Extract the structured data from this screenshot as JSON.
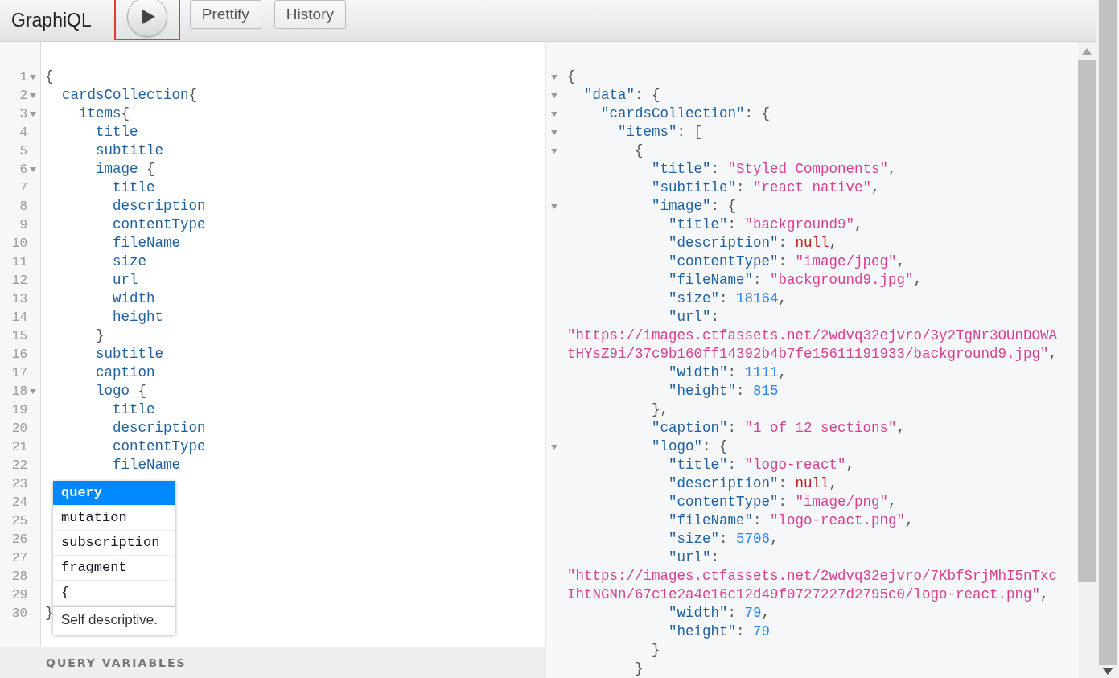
{
  "toolbar": {
    "title": "GraphiQL",
    "run_button": {
      "highlighted": true
    },
    "buttons": [
      "Prettify",
      "History"
    ]
  },
  "query_editor": {
    "lines": [
      {
        "n": "1",
        "fold": true,
        "code": [
          {
            "kind": "punct",
            "text": "{"
          }
        ]
      },
      {
        "n": "2",
        "fold": true,
        "code": [
          {
            "kind": "field",
            "text": "  cardsCollection"
          },
          {
            "kind": "punct",
            "text": "{"
          }
        ]
      },
      {
        "n": "3",
        "fold": true,
        "code": [
          {
            "kind": "field",
            "text": "    items"
          },
          {
            "kind": "punct",
            "text": "{"
          }
        ]
      },
      {
        "n": "4",
        "fold": false,
        "code": [
          {
            "kind": "field",
            "text": "      title"
          }
        ]
      },
      {
        "n": "5",
        "fold": false,
        "code": [
          {
            "kind": "field",
            "text": "      subtitle"
          }
        ]
      },
      {
        "n": "6",
        "fold": true,
        "code": [
          {
            "kind": "field",
            "text": "      image "
          },
          {
            "kind": "punct",
            "text": "{"
          }
        ]
      },
      {
        "n": "7",
        "fold": false,
        "code": [
          {
            "kind": "field",
            "text": "        title"
          }
        ]
      },
      {
        "n": "8",
        "fold": false,
        "code": [
          {
            "kind": "field",
            "text": "        description"
          }
        ]
      },
      {
        "n": "9",
        "fold": false,
        "code": [
          {
            "kind": "field",
            "text": "        contentType"
          }
        ]
      },
      {
        "n": "10",
        "fold": false,
        "code": [
          {
            "kind": "field",
            "text": "        fileName"
          }
        ]
      },
      {
        "n": "11",
        "fold": false,
        "code": [
          {
            "kind": "field",
            "text": "        size"
          }
        ]
      },
      {
        "n": "12",
        "fold": false,
        "code": [
          {
            "kind": "field",
            "text": "        url"
          }
        ]
      },
      {
        "n": "13",
        "fold": false,
        "code": [
          {
            "kind": "field",
            "text": "        width"
          }
        ]
      },
      {
        "n": "14",
        "fold": false,
        "code": [
          {
            "kind": "field",
            "text": "        height"
          }
        ]
      },
      {
        "n": "15",
        "fold": false,
        "code": [
          {
            "kind": "punct",
            "text": "      }"
          }
        ]
      },
      {
        "n": "16",
        "fold": false,
        "code": [
          {
            "kind": "field",
            "text": "      subtitle"
          }
        ]
      },
      {
        "n": "17",
        "fold": false,
        "code": [
          {
            "kind": "field",
            "text": "      caption"
          }
        ]
      },
      {
        "n": "18",
        "fold": true,
        "code": [
          {
            "kind": "field",
            "text": "      logo "
          },
          {
            "kind": "punct",
            "text": "{"
          }
        ]
      },
      {
        "n": "19",
        "fold": false,
        "code": [
          {
            "kind": "field",
            "text": "        title"
          }
        ]
      },
      {
        "n": "20",
        "fold": false,
        "code": [
          {
            "kind": "field",
            "text": "        description"
          }
        ]
      },
      {
        "n": "21",
        "fold": false,
        "code": [
          {
            "kind": "field",
            "text": "        contentType"
          }
        ]
      },
      {
        "n": "22",
        "fold": false,
        "code": [
          {
            "kind": "field",
            "text": "        fileName"
          }
        ]
      },
      {
        "n": "23",
        "fold": false
      },
      {
        "n": "24",
        "fold": false
      },
      {
        "n": "25",
        "fold": false
      },
      {
        "n": "26",
        "fold": false
      },
      {
        "n": "27",
        "fold": false
      },
      {
        "n": "28",
        "fold": false
      },
      {
        "n": "29",
        "fold": false
      },
      {
        "n": "30",
        "fold": false,
        "code": [
          {
            "kind": "punct",
            "text": "}"
          }
        ]
      }
    ],
    "autocomplete": {
      "items": [
        {
          "label": "query",
          "selected": true
        },
        {
          "label": "mutation",
          "selected": false
        },
        {
          "label": "subscription",
          "selected": false
        },
        {
          "label": "fragment",
          "selected": false
        },
        {
          "label": "{",
          "selected": false
        }
      ],
      "description": "Self descriptive."
    },
    "variables_label": "QUERY VARIABLES"
  },
  "result": {
    "lines": [
      {
        "fold": true,
        "code": [
          {
            "kind": "punct",
            "text": "{"
          }
        ]
      },
      {
        "fold": true,
        "code": [
          {
            "kind": "key",
            "text": "  \"data\""
          },
          {
            "kind": "punct",
            "text": ": {"
          }
        ]
      },
      {
        "fold": true,
        "code": [
          {
            "kind": "key",
            "text": "    \"cardsCollection\""
          },
          {
            "kind": "punct",
            "text": ": {"
          }
        ]
      },
      {
        "fold": true,
        "code": [
          {
            "kind": "key",
            "text": "      \"items\""
          },
          {
            "kind": "punct",
            "text": ": ["
          }
        ]
      },
      {
        "fold": true,
        "code": [
          {
            "kind": "punct",
            "text": "        {"
          }
        ]
      },
      {
        "fold": false,
        "code": [
          {
            "kind": "key",
            "text": "          \"title\""
          },
          {
            "kind": "punct",
            "text": ": "
          },
          {
            "kind": "string",
            "text": "\"Styled Components\""
          },
          {
            "kind": "punct",
            "text": ","
          }
        ]
      },
      {
        "fold": false,
        "code": [
          {
            "kind": "key",
            "text": "          \"subtitle\""
          },
          {
            "kind": "punct",
            "text": ": "
          },
          {
            "kind": "string",
            "text": "\"react native\""
          },
          {
            "kind": "punct",
            "text": ","
          }
        ]
      },
      {
        "fold": true,
        "code": [
          {
            "kind": "key",
            "text": "          \"image\""
          },
          {
            "kind": "punct",
            "text": ": {"
          }
        ]
      },
      {
        "fold": false,
        "code": [
          {
            "kind": "key",
            "text": "            \"title\""
          },
          {
            "kind": "punct",
            "text": ": "
          },
          {
            "kind": "string",
            "text": "\"background9\""
          },
          {
            "kind": "punct",
            "text": ","
          }
        ]
      },
      {
        "fold": false,
        "code": [
          {
            "kind": "key",
            "text": "            \"description\""
          },
          {
            "kind": "punct",
            "text": ": "
          },
          {
            "kind": "null",
            "text": "null"
          },
          {
            "kind": "punct",
            "text": ","
          }
        ]
      },
      {
        "fold": false,
        "code": [
          {
            "kind": "key",
            "text": "            \"contentType\""
          },
          {
            "kind": "punct",
            "text": ": "
          },
          {
            "kind": "string",
            "text": "\"image/jpeg\""
          },
          {
            "kind": "punct",
            "text": ","
          }
        ]
      },
      {
        "fold": false,
        "code": [
          {
            "kind": "key",
            "text": "            \"fileName\""
          },
          {
            "kind": "punct",
            "text": ": "
          },
          {
            "kind": "string",
            "text": "\"background9.jpg\""
          },
          {
            "kind": "punct",
            "text": ","
          }
        ]
      },
      {
        "fold": false,
        "code": [
          {
            "kind": "key",
            "text": "            \"size\""
          },
          {
            "kind": "punct",
            "text": ": "
          },
          {
            "kind": "number",
            "text": "18164"
          },
          {
            "kind": "punct",
            "text": ","
          }
        ]
      },
      {
        "fold": false,
        "code": [
          {
            "kind": "key",
            "text": "            \"url\""
          },
          {
            "kind": "punct",
            "text": ":"
          }
        ]
      },
      {
        "fold": false,
        "code": [
          {
            "kind": "string",
            "text": "\"https://images.ctfassets.net/2wdvq32ejvro/3y2TgNr3OUnDOWA"
          }
        ]
      },
      {
        "fold": false,
        "code": [
          {
            "kind": "string",
            "text": "tHYsZ9i/37c9b160ff14392b4b7fe15611191933/background9.jpg\""
          },
          {
            "kind": "punct",
            "text": ","
          }
        ]
      },
      {
        "fold": false,
        "code": [
          {
            "kind": "key",
            "text": "            \"width\""
          },
          {
            "kind": "punct",
            "text": ": "
          },
          {
            "kind": "number",
            "text": "1111"
          },
          {
            "kind": "punct",
            "text": ","
          }
        ]
      },
      {
        "fold": false,
        "code": [
          {
            "kind": "key",
            "text": "            \"height\""
          },
          {
            "kind": "punct",
            "text": ": "
          },
          {
            "kind": "number",
            "text": "815"
          }
        ]
      },
      {
        "fold": false,
        "code": [
          {
            "kind": "punct",
            "text": "          },"
          }
        ]
      },
      {
        "fold": false,
        "code": [
          {
            "kind": "key",
            "text": "          \"caption\""
          },
          {
            "kind": "punct",
            "text": ": "
          },
          {
            "kind": "string",
            "text": "\"1 of 12 sections\""
          },
          {
            "kind": "punct",
            "text": ","
          }
        ]
      },
      {
        "fold": true,
        "code": [
          {
            "kind": "key",
            "text": "          \"logo\""
          },
          {
            "kind": "punct",
            "text": ": {"
          }
        ]
      },
      {
        "fold": false,
        "code": [
          {
            "kind": "key",
            "text": "            \"title\""
          },
          {
            "kind": "punct",
            "text": ": "
          },
          {
            "kind": "string",
            "text": "\"logo-react\""
          },
          {
            "kind": "punct",
            "text": ","
          }
        ]
      },
      {
        "fold": false,
        "code": [
          {
            "kind": "key",
            "text": "            \"description\""
          },
          {
            "kind": "punct",
            "text": ": "
          },
          {
            "kind": "null",
            "text": "null"
          },
          {
            "kind": "punct",
            "text": ","
          }
        ]
      },
      {
        "fold": false,
        "code": [
          {
            "kind": "key",
            "text": "            \"contentType\""
          },
          {
            "kind": "punct",
            "text": ": "
          },
          {
            "kind": "string",
            "text": "\"image/png\""
          },
          {
            "kind": "punct",
            "text": ","
          }
        ]
      },
      {
        "fold": false,
        "code": [
          {
            "kind": "key",
            "text": "            \"fileName\""
          },
          {
            "kind": "punct",
            "text": ": "
          },
          {
            "kind": "string",
            "text": "\"logo-react.png\""
          },
          {
            "kind": "punct",
            "text": ","
          }
        ]
      },
      {
        "fold": false,
        "code": [
          {
            "kind": "key",
            "text": "            \"size\""
          },
          {
            "kind": "punct",
            "text": ": "
          },
          {
            "kind": "number",
            "text": "5706"
          },
          {
            "kind": "punct",
            "text": ","
          }
        ]
      },
      {
        "fold": false,
        "code": [
          {
            "kind": "key",
            "text": "            \"url\""
          },
          {
            "kind": "punct",
            "text": ":"
          }
        ]
      },
      {
        "fold": false,
        "code": [
          {
            "kind": "string",
            "text": "\"https://images.ctfassets.net/2wdvq32ejvro/7KbfSrjMhI5nTxc"
          }
        ]
      },
      {
        "fold": false,
        "code": [
          {
            "kind": "string",
            "text": "IhtNGNn/67c1e2a4e16c12d49f0727227d2795c0/logo-react.png\""
          },
          {
            "kind": "punct",
            "text": ","
          }
        ]
      },
      {
        "fold": false,
        "code": [
          {
            "kind": "key",
            "text": "            \"width\""
          },
          {
            "kind": "punct",
            "text": ": "
          },
          {
            "kind": "number",
            "text": "79"
          },
          {
            "kind": "punct",
            "text": ","
          }
        ]
      },
      {
        "fold": false,
        "code": [
          {
            "kind": "key",
            "text": "            \"height\""
          },
          {
            "kind": "punct",
            "text": ": "
          },
          {
            "kind": "number",
            "text": "79"
          }
        ]
      },
      {
        "fold": false,
        "code": [
          {
            "kind": "punct",
            "text": "          }"
          }
        ]
      },
      {
        "fold": false,
        "code": [
          {
            "kind": "punct",
            "text": "        }"
          }
        ]
      }
    ]
  }
}
